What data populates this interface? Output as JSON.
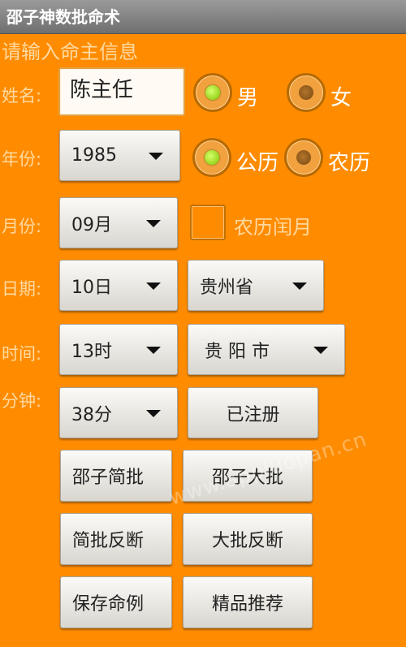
{
  "app": {
    "title": "邵子神数批命术"
  },
  "form": {
    "hint": "请输入命主信息",
    "name_label": "姓名:",
    "name_value": "陈主任",
    "gender": {
      "male": "男",
      "female": "女",
      "selected": "male"
    },
    "year_label": "年份:",
    "year_value": "1985",
    "calendar": {
      "solar": "公历",
      "lunar": "农历",
      "selected": "solar"
    },
    "month_label": "月份:",
    "month_value": "09月",
    "leap_month_label": "农历闰月",
    "leap_month_checked": false,
    "day_label": "日期:",
    "day_value": "10日",
    "province_value": "贵州省",
    "time_label": "时间:",
    "hour_value": "13时",
    "city_value": "贵 阳 市",
    "minute_label": "分钟:",
    "minute_value": "38分",
    "registered_label": "已注册"
  },
  "actions": {
    "shao_brief": "邵子简批",
    "shao_full": "邵子大批",
    "brief_reverse": "简批反断",
    "full_reverse": "大批反断",
    "save_case": "保存命例",
    "recommend": "精品推荐"
  },
  "watermark": "www.appluopan.cn",
  "colors": {
    "background": "#ff8c00",
    "titlebar": "#7f7f7f"
  }
}
